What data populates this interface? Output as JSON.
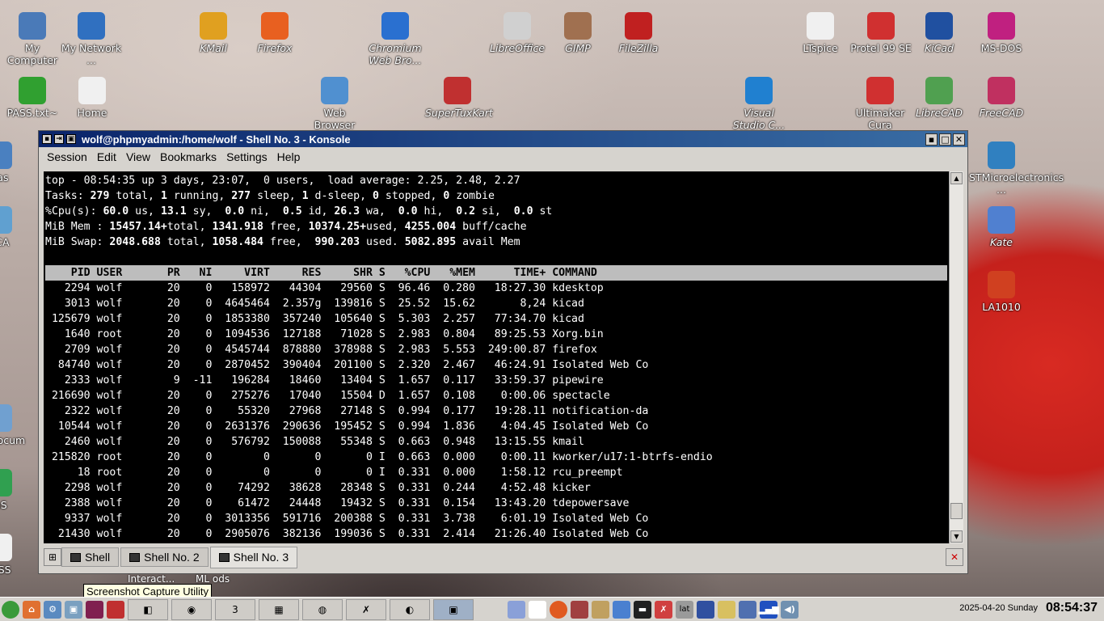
{
  "desktop_icons": [
    {
      "label": "My Computer",
      "icon": "computer-icon",
      "italic": false
    },
    {
      "label": "My Network ...",
      "icon": "network-globe-icon",
      "italic": false
    },
    {
      "label": "KMail",
      "icon": "kmail-icon",
      "italic": true
    },
    {
      "label": "Firefox",
      "icon": "firefox-icon",
      "italic": true
    },
    {
      "label": "Chromium Web Bro...",
      "icon": "chromium-icon",
      "italic": true
    },
    {
      "label": "LibreOffice",
      "icon": "libreoffice-icon",
      "italic": true
    },
    {
      "label": "GIMP",
      "icon": "gimp-icon",
      "italic": true
    },
    {
      "label": "FileZilla",
      "icon": "filezilla-icon",
      "italic": true
    },
    {
      "label": "LTspice",
      "icon": "ltspice-icon",
      "italic": false
    },
    {
      "label": "Protel 99 SE",
      "icon": "protel-icon",
      "italic": false
    },
    {
      "label": "KiCad",
      "icon": "kicad-icon",
      "italic": true
    },
    {
      "label": "MS-DOS",
      "icon": "msdos-icon",
      "italic": false
    },
    {
      "label": "PASS.txt~",
      "icon": "text-file-icon",
      "italic": false
    },
    {
      "label": "Home",
      "icon": "home-folder-icon",
      "italic": false
    },
    {
      "label": "Web Browser",
      "icon": "web-browser-icon",
      "italic": false
    },
    {
      "label": "SuperTuxKart",
      "icon": "supertuxkart-icon",
      "italic": true
    },
    {
      "label": "Visual Studio C...",
      "icon": "vscode-icon",
      "italic": true
    },
    {
      "label": "Ultimaker Cura",
      "icon": "cura-icon",
      "italic": false
    },
    {
      "label": "LibreCAD",
      "icon": "librecad-icon",
      "italic": true
    },
    {
      "label": "FreeCAD",
      "icon": "freecad-icon",
      "italic": true
    },
    {
      "label": "STMicroelectronics ...",
      "icon": "stm-ide-icon",
      "italic": false
    },
    {
      "label": "Kate",
      "icon": "kate-icon",
      "italic": true
    },
    {
      "label": "LA1010",
      "icon": "la1010-icon",
      "italic": false
    },
    {
      "label": "Tras",
      "icon": "trash-icon",
      "italic": false
    },
    {
      "label": "QCA",
      "icon": "qca-icon",
      "italic": false
    },
    {
      "label": "My Docum",
      "icon": "documents-icon",
      "italic": false
    },
    {
      "label": "YaS",
      "icon": "yast-icon",
      "italic": false
    },
    {
      "label": "PASS",
      "icon": "text-file-icon",
      "italic": false
    }
  ],
  "window": {
    "title": "wolf@phpmyadmin:/home/wolf - Shell No. 3 - Konsole",
    "menu": [
      "Session",
      "Edit",
      "View",
      "Bookmarks",
      "Settings",
      "Help"
    ],
    "tabs": [
      "Shell",
      "Shell No. 2",
      "Shell No. 3"
    ],
    "active_tab": 2
  },
  "top": {
    "summary": [
      "top - 08:54:35 up 3 days, 23:07,  0 users,  load average: 2.25, 2.48, 2.27",
      "Tasks: 279 total, 1 running, 277 sleep, 1 d-sleep, 0 stopped, 0 zombie",
      "%Cpu(s): 60.0 us, 13.1 sy,  0.0 ni,  0.5 id, 26.3 wa,  0.0 hi,  0.2 si,  0.0 st",
      "MiB Mem : 15457.14+total, 1341.918 free, 10374.25+used, 4255.004 buff/cache",
      "MiB Swap: 2048.688 total, 1058.484 free,  990.203 used. 5082.895 avail Mem"
    ],
    "columns": [
      "PID",
      "USER",
      "PR",
      "NI",
      "VIRT",
      "RES",
      "SHR",
      "S",
      "%CPU",
      "%MEM",
      "TIME+",
      "COMMAND"
    ],
    "processes": [
      [
        "2294",
        "wolf",
        "20",
        "0",
        "158972",
        "44304",
        "29560",
        "S",
        "96.46",
        "0.280",
        "18:27.30",
        "kdesktop"
      ],
      [
        "3013",
        "wolf",
        "20",
        "0",
        "4645464",
        "2.357g",
        "139816",
        "S",
        "25.52",
        "15.62",
        "8,24",
        "kicad"
      ],
      [
        "125679",
        "wolf",
        "20",
        "0",
        "1853380",
        "357240",
        "105640",
        "S",
        "5.303",
        "2.257",
        "77:34.70",
        "kicad"
      ],
      [
        "1640",
        "root",
        "20",
        "0",
        "1094536",
        "127188",
        "71028",
        "S",
        "2.983",
        "0.804",
        "89:25.53",
        "Xorg.bin"
      ],
      [
        "2709",
        "wolf",
        "20",
        "0",
        "4545744",
        "878880",
        "378988",
        "S",
        "2.983",
        "5.553",
        "249:00.87",
        "firefox"
      ],
      [
        "84740",
        "wolf",
        "20",
        "0",
        "2870452",
        "390404",
        "201100",
        "S",
        "2.320",
        "2.467",
        "46:24.91",
        "Isolated Web Co"
      ],
      [
        "2333",
        "wolf",
        "9",
        "-11",
        "196284",
        "18460",
        "13404",
        "S",
        "1.657",
        "0.117",
        "33:59.37",
        "pipewire"
      ],
      [
        "216690",
        "wolf",
        "20",
        "0",
        "275276",
        "17040",
        "15504",
        "D",
        "1.657",
        "0.108",
        "0:00.06",
        "spectacle"
      ],
      [
        "2322",
        "wolf",
        "20",
        "0",
        "55320",
        "27968",
        "27148",
        "S",
        "0.994",
        "0.177",
        "19:28.11",
        "notification-da"
      ],
      [
        "10544",
        "wolf",
        "20",
        "0",
        "2631376",
        "290636",
        "195452",
        "S",
        "0.994",
        "1.836",
        "4:04.45",
        "Isolated Web Co"
      ],
      [
        "2460",
        "wolf",
        "20",
        "0",
        "576792",
        "150088",
        "55348",
        "S",
        "0.663",
        "0.948",
        "13:15.55",
        "kmail"
      ],
      [
        "215820",
        "root",
        "20",
        "0",
        "0",
        "0",
        "0",
        "I",
        "0.663",
        "0.000",
        "0:00.11",
        "kworker/u17:1-btrfs-endio"
      ],
      [
        "18",
        "root",
        "20",
        "0",
        "0",
        "0",
        "0",
        "I",
        "0.331",
        "0.000",
        "1:58.12",
        "rcu_preempt"
      ],
      [
        "2298",
        "wolf",
        "20",
        "0",
        "74292",
        "38628",
        "28348",
        "S",
        "0.331",
        "0.244",
        "4:52.48",
        "kicker"
      ],
      [
        "2388",
        "wolf",
        "20",
        "0",
        "61472",
        "24448",
        "19432",
        "S",
        "0.331",
        "0.154",
        "13:43.20",
        "tdepowersave"
      ],
      [
        "9337",
        "wolf",
        "20",
        "0",
        "3013356",
        "591716",
        "200388",
        "S",
        "0.331",
        "3.738",
        "6:01.19",
        "Isolated Web Co"
      ],
      [
        "21430",
        "wolf",
        "20",
        "0",
        "2905076",
        "382136",
        "199036",
        "S",
        "0.331",
        "2.414",
        "21:26.40",
        "Isolated Web Co"
      ]
    ]
  },
  "tooltip": "Screenshot Capture Utility",
  "behind_labels": [
    "Interact...",
    "ML ods"
  ],
  "taskbar": {
    "kb_layout": "lat",
    "date": "2025-04-20",
    "weekday": "Sunday",
    "time": "08:54:37",
    "task_button_label": "3"
  },
  "colors": {
    "titlebar": "#0a246a",
    "terminal_bg": "#000000",
    "terminal_fg": "#ffffff",
    "header_bg": "#bdbdbd"
  }
}
